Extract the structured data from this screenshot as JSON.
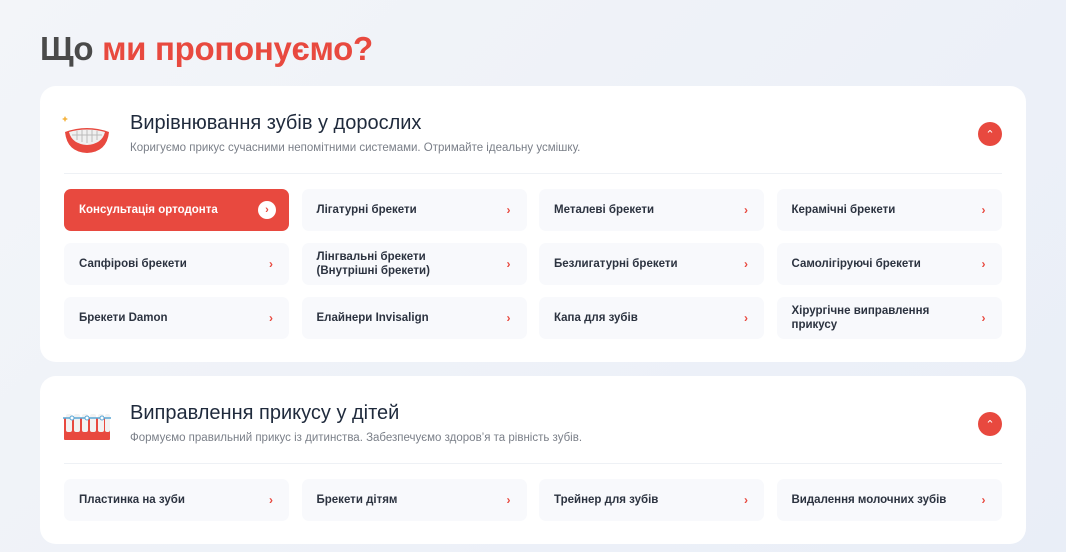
{
  "page": {
    "title_plain": "Що",
    "title_accent": "ми пропонуємо?"
  },
  "sections": [
    {
      "title": "Вирівнювання зубів у дорослих",
      "subtitle": "Коригуємо прикус сучасними непомітними системами. Отримайте ідеальну усмішку.",
      "icon": "smile-braces-icon",
      "items": [
        "Консультація ортодонта",
        "Лігатурні брекети",
        "Металеві брекети",
        "Керамічні брекети",
        "Сапфірові брекети",
        "Лінгвальні брекети (Внутрішні брекети)",
        "Безлигатурні брекети",
        "Самолігіруючі брекети",
        "Брекети Damon",
        "Елайнери Invisalign",
        "Капа для зубів",
        "Хірургічне виправлення прикусу"
      ]
    },
    {
      "title": "Виправлення прикусу у дітей",
      "subtitle": "Формуємо правильний прикус із дитинства. Забезпечуємо здоров’я та рівність зубів.",
      "icon": "teeth-braces-icon",
      "items": [
        "Пластинка на зуби",
        "Брекети дітям",
        "Трейнер для зубів",
        "Видалення молочних зубів"
      ]
    }
  ],
  "colors": {
    "accent": "#e8493f",
    "text": "#1f2a3c"
  }
}
